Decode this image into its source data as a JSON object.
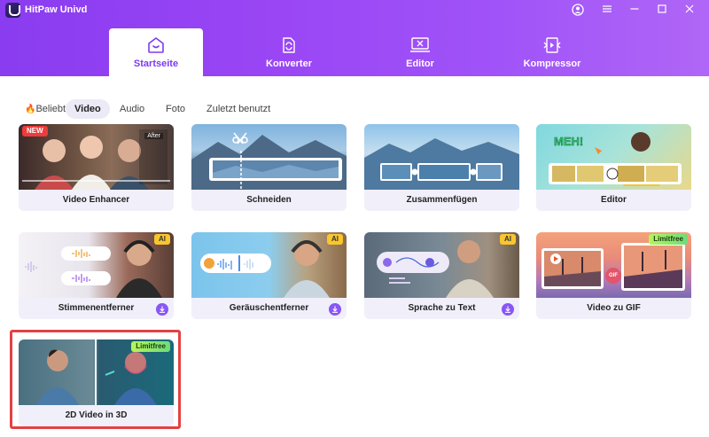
{
  "app": {
    "title": "HitPaw Univd"
  },
  "nav": [
    {
      "label": "Startseite",
      "icon": "home-icon",
      "active": true
    },
    {
      "label": "Konverter",
      "icon": "convert-icon",
      "active": false
    },
    {
      "label": "Editor",
      "icon": "editor-icon",
      "active": false
    },
    {
      "label": "Kompressor",
      "icon": "compress-icon",
      "active": false
    }
  ],
  "categories": [
    {
      "label": "Beliebt",
      "icon": "fire-icon",
      "active": false
    },
    {
      "label": "Video",
      "active": true
    },
    {
      "label": "Audio",
      "active": false
    },
    {
      "label": "Foto",
      "active": false
    },
    {
      "label": "Zuletzt benutzt",
      "active": false
    }
  ],
  "cards": [
    {
      "label": "Video Enhancer",
      "badge": "NEW",
      "overlay_text": "After"
    },
    {
      "label": "Schneiden"
    },
    {
      "label": "Zusammenfügen"
    },
    {
      "label": "Editor",
      "overlay_text": "MEH!"
    },
    {
      "label": "Stimmenentferner",
      "badge": "AI",
      "download": true
    },
    {
      "label": "Geräuschentferner",
      "badge": "AI",
      "download": true
    },
    {
      "label": "Sprache zu Text",
      "badge": "AI",
      "download": true
    },
    {
      "label": "Video zu GIF",
      "badge": "Limitfree",
      "overlay_text": "GIF"
    },
    {
      "label": "2D Video in 3D",
      "badge": "Limitfree",
      "highlighted": true
    }
  ],
  "colors": {
    "accent": "#8a3cf0",
    "highlight": "#e24242",
    "card_bg": "#f1effa"
  }
}
